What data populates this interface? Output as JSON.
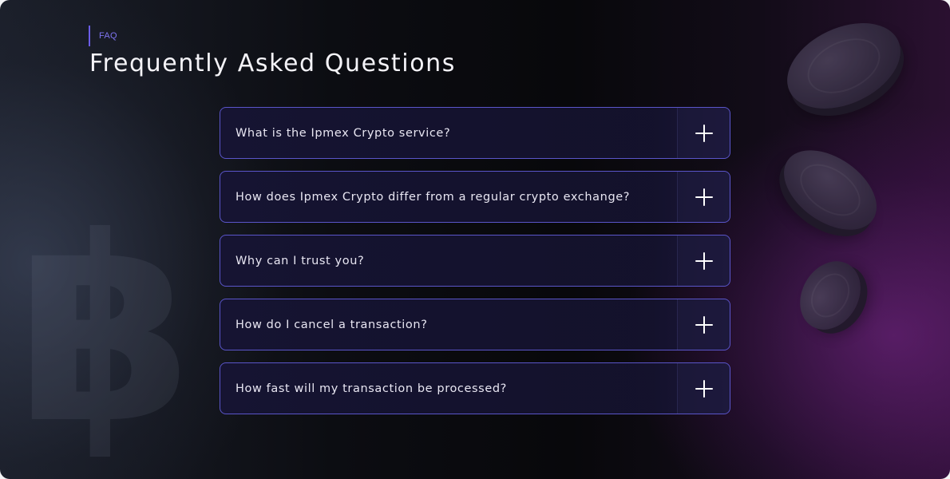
{
  "header": {
    "eyebrow": "FAQ",
    "title": "Frequently Asked Questions"
  },
  "faq": {
    "items": [
      {
        "question": "What is the Ipmex Crypto service?",
        "icon": "plus-icon"
      },
      {
        "question": "How does Ipmex Crypto differ from a regular crypto exchange?",
        "icon": "plus-icon"
      },
      {
        "question": "Why can I trust you?",
        "icon": "plus-icon"
      },
      {
        "question": "How do I cancel a transaction?",
        "icon": "plus-icon"
      },
      {
        "question": "How fast will my transaction be processed?",
        "icon": "plus-icon"
      }
    ]
  },
  "decor": {
    "left_symbol": "bitcoin-symbol",
    "right_art": "floating-coins"
  },
  "colors": {
    "accent": "#6b5de8",
    "card_border": "#5a55c9",
    "title": "#f4f3f8"
  }
}
